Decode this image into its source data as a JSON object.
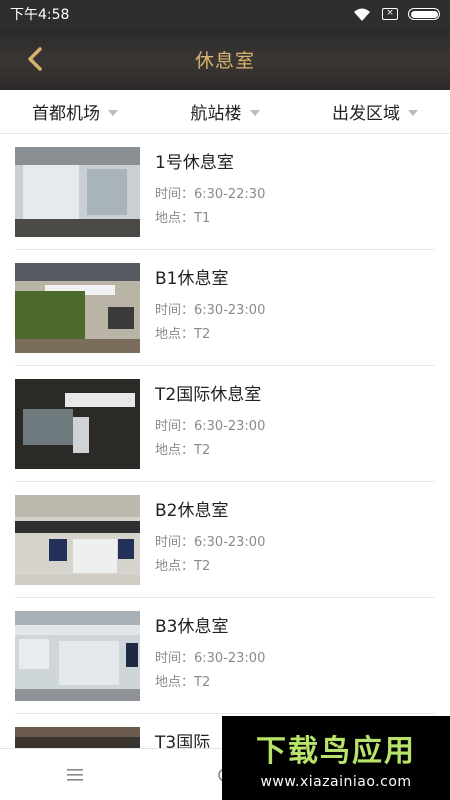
{
  "status_bar": {
    "time": "下午4:58",
    "icons": [
      "wifi-icon",
      "sim-icon",
      "battery-icon"
    ],
    "sim_label": "×"
  },
  "header": {
    "title": "休息室",
    "back_icon": "chevron-left-icon",
    "title_color": "#d8b26e"
  },
  "filters": [
    {
      "label": "首都机场"
    },
    {
      "label": "航站楼"
    },
    {
      "label": "出发区域"
    }
  ],
  "lounges": [
    {
      "name": "1号休息室",
      "time": "时间：6:30-22:30",
      "location": "地点：T1"
    },
    {
      "name": "B1休息室",
      "time": "时间：6:30-23:00",
      "location": "地点：T2"
    },
    {
      "name": "T2国际休息室",
      "time": "时间：6:30-23:00",
      "location": "地点：T2"
    },
    {
      "name": "B2休息室",
      "time": "时间：6:30-23:00",
      "location": "地点：T2"
    },
    {
      "name": "B3休息室",
      "time": "时间：6:30-23:00",
      "location": "地点：T2"
    },
    {
      "name": "T3国际",
      "time": "",
      "location": ""
    }
  ],
  "bottom_nav": {
    "icons": [
      "menu-icon",
      "home-icon",
      "back-icon"
    ]
  },
  "watermark": {
    "logo": "下载鸟应用",
    "url": "www.xiazainiao.com"
  }
}
